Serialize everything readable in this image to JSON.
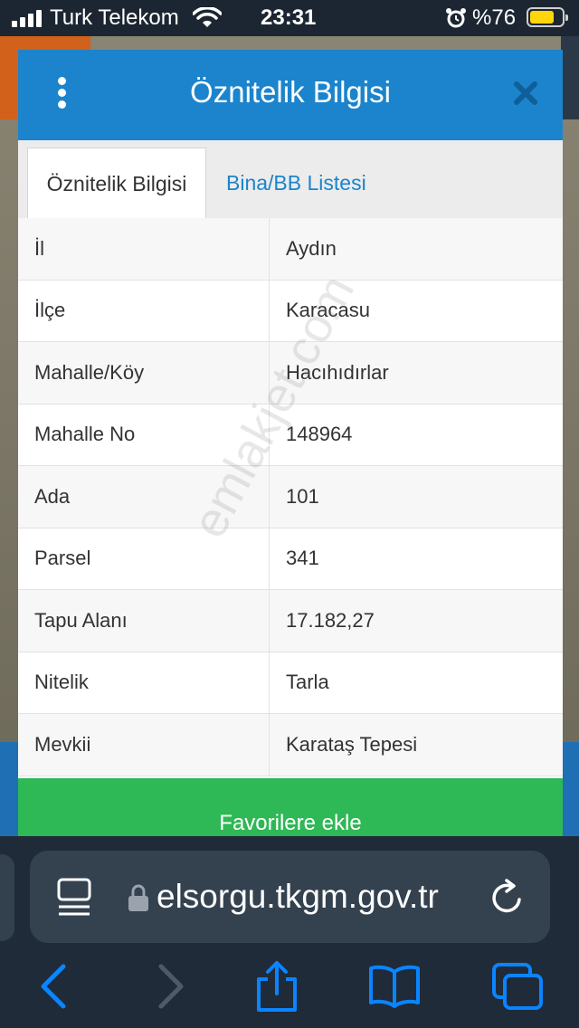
{
  "status_bar": {
    "carrier": "Turk Telekom",
    "time": "23:31",
    "battery_percent": "%76",
    "battery_level": 0.76,
    "icons": [
      "signal-icon",
      "wifi-icon",
      "alarm-icon",
      "battery-icon"
    ]
  },
  "dialog": {
    "title": "Öznitelik Bilgisi",
    "tabs": [
      {
        "label": "Öznitelik Bilgisi",
        "active": true
      },
      {
        "label": "Bina/BB Listesi",
        "active": false
      }
    ],
    "rows": [
      {
        "key": "İl",
        "value": "Aydın"
      },
      {
        "key": "İlçe",
        "value": "Karacasu"
      },
      {
        "key": "Mahalle/Köy",
        "value": "Hacıhıdırlar"
      },
      {
        "key": "Mahalle No",
        "value": "148964"
      },
      {
        "key": "Ada",
        "value": "101"
      },
      {
        "key": "Parsel",
        "value": "341"
      },
      {
        "key": "Tapu Alanı",
        "value": "17.182,27"
      },
      {
        "key": "Nitelik",
        "value": "Tarla"
      },
      {
        "key": "Mevkii",
        "value": "Karataş Tepesi"
      }
    ],
    "favorite_button": "Favorilere ekle",
    "watermark": "emlakjet.com"
  },
  "browser": {
    "url": "parselsorgu.tkgm.gov.tr",
    "url_visible": "elsorgu.tkgm.gov.tr"
  },
  "colors": {
    "header_blue": "#1b84cc",
    "button_green": "#2fb856",
    "ios_blue": "#0a84ff"
  }
}
